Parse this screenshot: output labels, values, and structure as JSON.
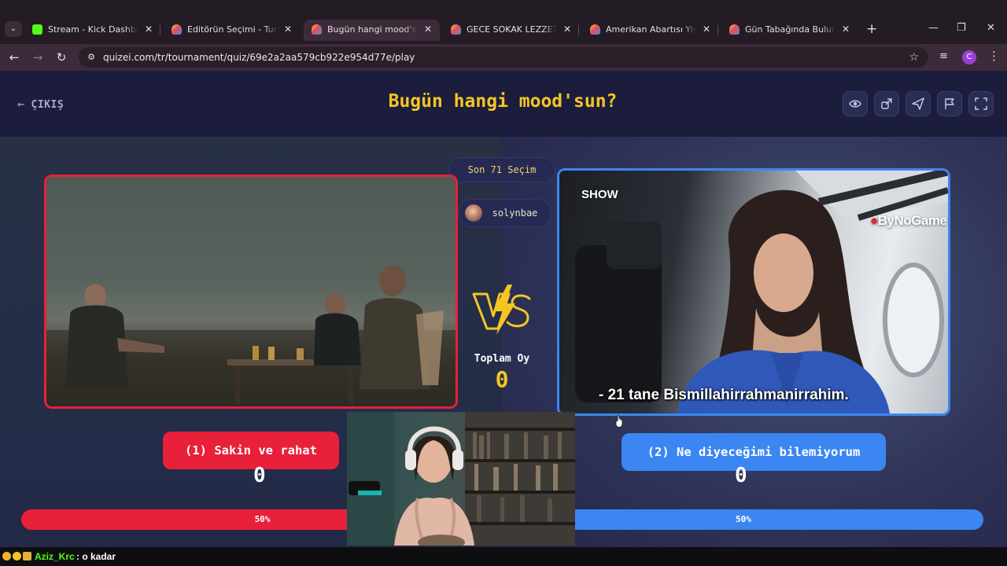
{
  "browser": {
    "tabs": [
      {
        "title": "Stream - Kick Dashboard",
        "favicon": "kick-icon",
        "active": false
      },
      {
        "title": "Editörün Seçimi - Turnuva",
        "favicon": "quizei-icon",
        "active": false
      },
      {
        "title": "Bugün hangi mood'sun? -",
        "favicon": "quizei-icon",
        "active": true
      },
      {
        "title": "GECE SOKAK LEZZETLERİ",
        "favicon": "quizei-icon",
        "active": false
      },
      {
        "title": "Amerikan Abartısı Yiyecekl",
        "favicon": "quizei-icon",
        "active": false
      },
      {
        "title": "Gün Tabağında Bulunan Le",
        "favicon": "quizei-icon",
        "active": false
      }
    ],
    "url": "quizei.com/tr/tournament/quiz/69e2a2aa579cb922e954d77e/play",
    "profile_initial": "C"
  },
  "header": {
    "exit_label": "ÇIKIŞ",
    "title": "Bugün hangi mood'sun?"
  },
  "center": {
    "recent_label": "Son 71 Seçim",
    "username": "solynbae",
    "total_label": "Toplam Oy",
    "total_value": "0"
  },
  "choices": [
    {
      "label": "(1) Sakin ve rahat",
      "votes": "0",
      "percent_label": "50%",
      "percent": 50,
      "color": "#e8203a"
    },
    {
      "label": "(2) Ne diyeceğimi bilemiyorum",
      "votes": "0",
      "percent_label": "50%",
      "percent": 50,
      "color": "#3b86f2"
    }
  ],
  "media_right": {
    "subtitle": "- 21 tane Bismillahirrahmanirrahim.",
    "channel_logo": "SHOW",
    "watermark": "ByNoGame"
  },
  "chat": {
    "username": "Aziz_Krc",
    "message": ": o kadar"
  },
  "colors": {
    "accent": "#f5c623",
    "red": "#e8203a",
    "blue": "#3b86f2",
    "background": "#1e1f3c"
  }
}
